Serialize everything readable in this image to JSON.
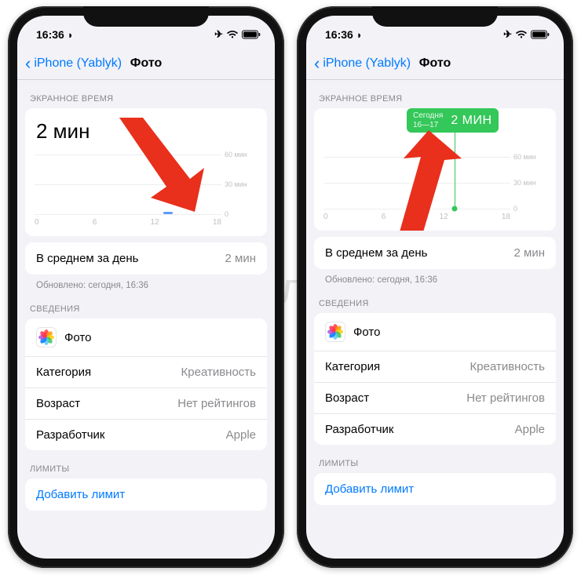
{
  "watermark": "Яблык",
  "status": {
    "time": "16:36",
    "moon_icon": "◗",
    "airplane_icon": "✈"
  },
  "nav": {
    "back_label": "iPhone (Yablyk)",
    "title": "Фото"
  },
  "sections": {
    "screen_time": "ЭКРАННОЕ ВРЕМЯ",
    "info": "СВЕДЕНИЯ",
    "limits": "ЛИМИТЫ"
  },
  "chart_data": {
    "type": "bar",
    "categories": [
      "0",
      "6",
      "12",
      "18"
    ],
    "values_minutes": [
      0,
      0,
      0,
      2
    ],
    "ylabels": [
      "60 мин",
      "30 мин",
      "0"
    ],
    "ylim": [
      0,
      60
    ],
    "total_label": "2 мин",
    "tooltip": {
      "day": "Сегодня",
      "range": "16—17",
      "value": "2 МИН"
    }
  },
  "avg_row": {
    "label": "В среднем за день",
    "value": "2 мин"
  },
  "updated": "Обновлено: сегодня, 16:36",
  "info_rows": {
    "app": {
      "label": "Фото"
    },
    "category": {
      "label": "Категория",
      "value": "Креативность"
    },
    "age": {
      "label": "Возраст",
      "value": "Нет рейтингов"
    },
    "developer": {
      "label": "Разработчик",
      "value": "Apple"
    }
  },
  "add_limit": "Добавить лимит",
  "arrow_colors": {
    "fill": "#e8301c"
  }
}
